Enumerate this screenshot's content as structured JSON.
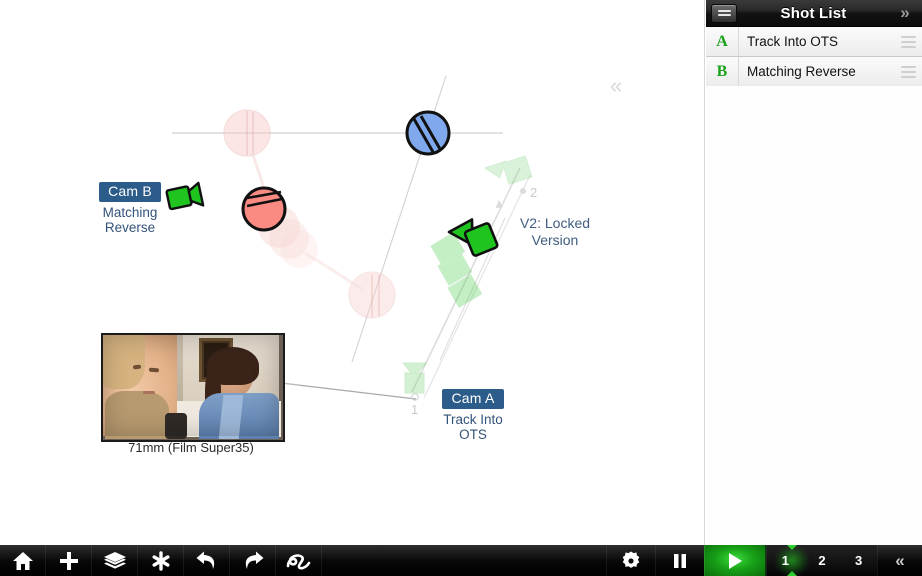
{
  "app": {
    "canvas_collapse_chevron": "«"
  },
  "canvas": {
    "cam_b": {
      "chip": "Cam B",
      "sub": "Matching\nReverse"
    },
    "cam_a": {
      "chip": "Cam A",
      "sub": "Track Into\nOTS"
    },
    "version_note": "V2: Locked\nVersion",
    "ghost_marker_1": "1",
    "ghost_marker_2": "2",
    "frame_caption": "71mm (Film Super35)",
    "colors": {
      "character_red": "#f98b82",
      "character_blue": "#7fa9ec",
      "camera_green": "#17c417",
      "label_blue": "#2b5c8a",
      "label_text": "#33537a"
    }
  },
  "shot_list": {
    "title": "Shot List",
    "menu_icon": "list-icon",
    "collapse_chevron": "»",
    "rows": [
      {
        "letter": "A",
        "name": "Track Into OTS"
      },
      {
        "letter": "B",
        "name": "Matching Reverse"
      }
    ]
  },
  "toolbar": {
    "left_tools": [
      {
        "name": "home",
        "icon": "home-icon"
      },
      {
        "name": "add",
        "icon": "plus-icon"
      },
      {
        "name": "layers",
        "icon": "layers-icon"
      },
      {
        "name": "effects",
        "icon": "asterisk-icon"
      },
      {
        "name": "undo",
        "icon": "undo-arrow-icon"
      },
      {
        "name": "redo",
        "icon": "redo-arrow-icon"
      },
      {
        "name": "path",
        "icon": "squiggle-path-icon"
      }
    ],
    "settings_icon": "gear-icon",
    "pause_icon": "pause-icon",
    "play_icon": "play-icon",
    "steps": [
      "1",
      "2",
      "3"
    ],
    "active_step": "1",
    "end_chevron": "«"
  }
}
